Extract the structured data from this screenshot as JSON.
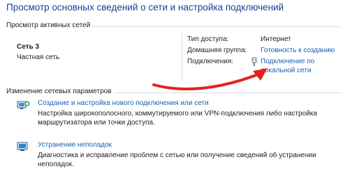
{
  "header": {
    "title": "Просмотр основных сведений о сети и настройка подключений"
  },
  "active_networks": {
    "heading": "Просмотр активных сетей",
    "network_name": "Сеть  3",
    "network_type": "Частная сеть",
    "access_type_label": "Тип доступа:",
    "access_type_value": "Интернет",
    "homegroup_label": "Домашняя группа:",
    "homegroup_value": "Готовность к созданию",
    "connections_label": "Подключения:",
    "connection_line1": "Подключение по",
    "connection_line2": "локальной сети"
  },
  "change_settings": {
    "heading": "Изменение сетевых параметров",
    "tasks": [
      {
        "title": "Создание и настройка нового подключения или сети",
        "desc": "Настройка широкополосного, коммутируемого или VPN-подключения либо настройка маршрутизатора или точки доступа.",
        "icon": "network-setup-icon"
      },
      {
        "title": "Устранение неполадок",
        "desc": "Диагностика и исправление проблем с сетью или получение сведений об устранении неполадок.",
        "icon": "troubleshoot-icon"
      }
    ]
  },
  "colors": {
    "title": "#1e3c96",
    "link": "#1a5fb4",
    "arrow": "#e2231a"
  }
}
